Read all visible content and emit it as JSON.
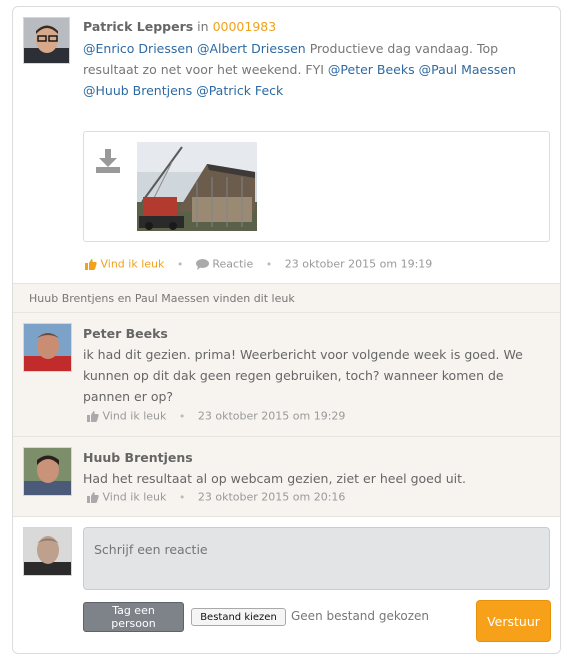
{
  "post": {
    "author": "Patrick Leppers",
    "in_label": "in",
    "ticket": "00001983",
    "mentions_a": [
      "@Enrico Driessen",
      "@Albert Driessen"
    ],
    "text_a": "Productieve dag vandaag. Top resultaat zo net voor het weekend. FYI",
    "mentions_b": [
      "@Peter Beeks",
      "@Paul Maessen",
      "@Huub Brentjens",
      "@Patrick Feck"
    ],
    "like_label": "Vind ik leuk",
    "reply_label": "Reactie",
    "timestamp": "23 oktober 2015 om 19:19"
  },
  "likes_text": "Huub Brentjens en Paul Maessen vinden dit leuk",
  "comments": [
    {
      "author": "Peter Beeks",
      "text": "ik had dit gezien. prima! Weerbericht voor volgende week is goed. We kunnen op dit dak geen regen gebruiken, toch? wanneer komen de pannen er op?",
      "like_label": "Vind ik leuk",
      "timestamp": "23 oktober 2015 om 19:29"
    },
    {
      "author": "Huub Brentjens",
      "text": "Had het resultaat al op webcam gezien, ziet er heel goed uit.",
      "like_label": "Vind ik leuk",
      "timestamp": "23 oktober 2015 om 20:16"
    }
  ],
  "reply": {
    "placeholder": "Schrijf een reactie",
    "tag_button": "Tag een persoon",
    "file_button": "Bestand kiezen",
    "file_status": "Geen bestand gekozen",
    "send_button": "Verstuur"
  },
  "icons": {
    "download": "download-icon",
    "like": "thumbs-up-icon",
    "comment": "speech-bubble-icon"
  },
  "colors": {
    "accent": "#f7a11a",
    "link": "#2d6aa3",
    "muted_background": "#f7f4f0"
  }
}
